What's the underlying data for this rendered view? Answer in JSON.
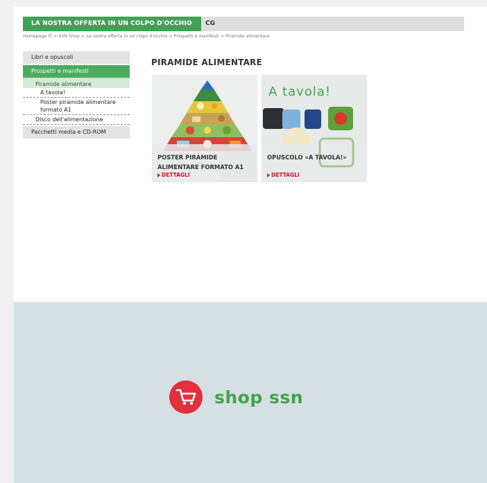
{
  "topbar": {
    "active_label": "LA NOSTRA OFFERTA IN UN COLPO D'OCCHIO",
    "secondary_label": "CG"
  },
  "breadcrumb": [
    "Homepage IT",
    "SSN Shop",
    "La nostra offerta in un colpo d'occhio",
    "Prospetti e manifesti",
    "Piramide alimentare"
  ],
  "breadcrumb_separator": ">",
  "sidebar": {
    "items": [
      {
        "label": "Libri e opuscoli"
      },
      {
        "label": "Prospetti e manifesti"
      },
      {
        "label": "Piramide alimentare"
      },
      {
        "label": "A tavola!"
      },
      {
        "label": "Poster piramide alimentare formato A1"
      },
      {
        "label": "Disco dell'alimentazione"
      },
      {
        "label": "Pacchetti media e CD-ROM"
      }
    ]
  },
  "main": {
    "title": "PIRAMIDE ALIMENTARE",
    "products": [
      {
        "name": "POSTER PIRAMIDE ALIMENTARE FORMATO A1",
        "link": "DETTAGLI"
      },
      {
        "name": "OPUSCOLO «A TAVOLA!»",
        "link": "DETTAGLI",
        "cover_title": "A tavola!"
      }
    ]
  },
  "footer": {
    "brand": "shop ssn",
    "icon": "cart-icon"
  },
  "colors": {
    "accent_green": "#42a157",
    "link_red": "#d4132a",
    "footer_bg": "#d6dfe4",
    "logo_red": "#e2303e"
  }
}
